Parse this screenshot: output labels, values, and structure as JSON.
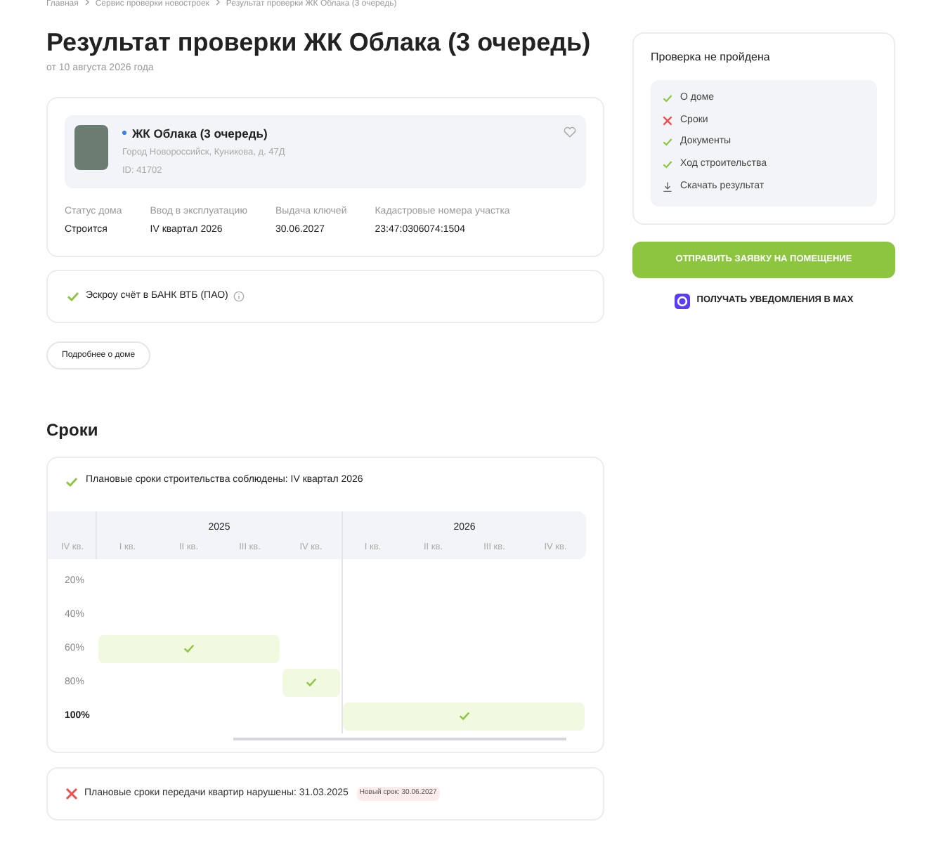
{
  "breadcrumbs": [
    "Главная",
    "Сервис проверки новостроек",
    "Результат проверки ЖК Облака (3 очередь)"
  ],
  "title": "Результат проверки ЖК Облака (3 очередь)",
  "subtitle": "от 10 августа 2026 года",
  "complex": {
    "name": "ЖК Облака (3 очередь)",
    "address": "Город Новороссийск, Куникова, д. 47Д",
    "id": "ID: 41702",
    "favorite": false,
    "facts": [
      {
        "label": "Статус дома",
        "value": "Строится"
      },
      {
        "label": "Ввод в эксплуатацию",
        "value": "IV квартал 2026"
      },
      {
        "label": "Выдача ключей",
        "value": "30.06.2027"
      },
      {
        "label": "Кадастровые номера участка",
        "value": "23:47:0306074:1504"
      }
    ]
  },
  "escrow": {
    "passed": true,
    "text": "Эскроу счёт в БАНК ВТБ (ПАО)"
  },
  "more_button": "Подробнее о доме",
  "terms": {
    "heading": "Сроки",
    "construction": {
      "passed": true,
      "text": "Плановые сроки строительства соблюдены: IV квартал 2026"
    },
    "years": [
      {
        "label": "2025"
      },
      {
        "label": "2026"
      }
    ],
    "quarters": [
      "IV кв.",
      "I кв.",
      "II кв.",
      "III кв.",
      "IV кв.",
      "I кв.",
      "II кв.",
      "III кв.",
      "IV кв."
    ],
    "rows": [
      {
        "label": "20%",
        "current": false,
        "cells": [
          false,
          false,
          false,
          false,
          false,
          false,
          false,
          false,
          false
        ]
      },
      {
        "label": "40%",
        "current": false,
        "cells": [
          false,
          false,
          false,
          false,
          false,
          false,
          false,
          false,
          false
        ]
      },
      {
        "label": "60%",
        "current": false,
        "cells": [
          false,
          true,
          true,
          true,
          false,
          false,
          false,
          false,
          false
        ]
      },
      {
        "label": "80%",
        "current": false,
        "cells": [
          false,
          false,
          false,
          false,
          true,
          false,
          false,
          false,
          false
        ]
      },
      {
        "label": "100%",
        "current": true,
        "cells": [
          false,
          false,
          false,
          false,
          false,
          true,
          true,
          true,
          true
        ]
      }
    ],
    "handover": {
      "passed": false,
      "text": "Плановые сроки передачи квартир нарушены: 31.03.2025",
      "badge": "Новый срок: 30.06.2027"
    }
  },
  "result": {
    "title": "Проверка не пройдена",
    "checks": [
      {
        "label": "О доме",
        "passed": true
      },
      {
        "label": "Сроки",
        "passed": false
      },
      {
        "label": "Документы",
        "passed": true
      },
      {
        "label": "Ход строительства",
        "passed": true
      }
    ],
    "download": "Скачать результат"
  },
  "submit_button": "ОТПРАВИТЬ ЗАЯВКУ НА ПОМЕЩЕНИЕ",
  "notify_link": "ПОЛУЧАТЬ УВЕДОМЛЕНИЯ В MAX"
}
